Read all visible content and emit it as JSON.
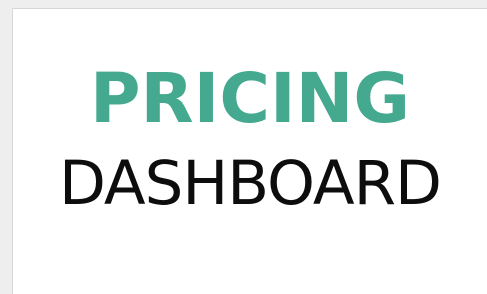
{
  "dashboard": {
    "title_accent": "PRICING",
    "title_main": "DASHBOARD"
  },
  "colors": {
    "accent": "#44a98f",
    "main": "#0d0d0d",
    "card": "#ffffff"
  }
}
